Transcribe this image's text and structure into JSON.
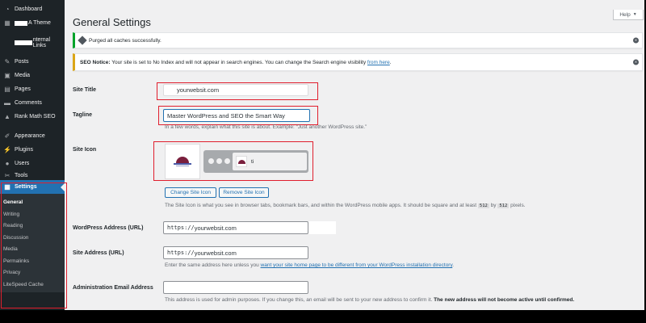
{
  "sidebar": {
    "items": [
      {
        "label": "Dashboard",
        "icon": "dashboard-icon",
        "glyph": "◔"
      },
      {
        "label": "A Theme",
        "icon": "theme-icon",
        "glyph": "▦",
        "redacted_prefix": true
      },
      {
        "label": "nternal Links",
        "icon": "link-icon",
        "glyph": "",
        "redacted_prefix_wide": true
      },
      {
        "label": "Posts",
        "icon": "pin-icon",
        "glyph": "✎"
      },
      {
        "label": "Media",
        "icon": "media-icon",
        "glyph": "▣"
      },
      {
        "label": "Pages",
        "icon": "pages-icon",
        "glyph": "▤"
      },
      {
        "label": "Comments",
        "icon": "comment-icon",
        "glyph": "▬"
      },
      {
        "label": "Rank Math SEO",
        "icon": "rank-math-icon",
        "glyph": "▲"
      },
      {
        "label": "Appearance",
        "icon": "brush-icon",
        "glyph": "✐"
      },
      {
        "label": "Plugins",
        "icon": "plugin-icon",
        "glyph": "⚡"
      },
      {
        "label": "Users",
        "icon": "user-icon",
        "glyph": "●"
      },
      {
        "label": "Tools",
        "icon": "wrench-icon",
        "glyph": "✂"
      },
      {
        "label": "Settings",
        "icon": "settings-icon",
        "glyph": "▦"
      }
    ],
    "submenu": [
      "General",
      "Writing",
      "Reading",
      "Discussion",
      "Media",
      "Permalinks",
      "Privacy",
      "LiteSpeed Cache"
    ],
    "accent": "#2271b1"
  },
  "header": {
    "title": "General Settings",
    "help_label": "Help",
    "help_arrow": "▼"
  },
  "notices": {
    "purge": "Purged all caches successfully.",
    "seo_bold": "SEO Notice:",
    "seo_text": " Your site is set to No Index and will not appear in search engines. You can change the Search engine visibility ",
    "seo_link": "from here",
    "seo_end": ".",
    "dismiss_glyph": "×"
  },
  "form": {
    "site_title": {
      "label": "Site Title",
      "value": "yourwebsit.com"
    },
    "tagline": {
      "label": "Tagline",
      "value": "Master WordPress and SEO the Smart Way",
      "desc": "In a few words, explain what this site is about. Example: “Just another WordPress site.”"
    },
    "site_icon": {
      "label": "Site Icon",
      "tab_title": "ti",
      "change_button": "Change Site Icon",
      "remove_button": "Remove Site Icon",
      "desc_pre": "The Site Icon is what you see in browser tabs, bookmark bars, and within the WordPress mobile apps. It should be square and at least ",
      "code1": "512",
      "by": " by ",
      "code2": "512",
      "desc_post": " pixels."
    },
    "wp_address": {
      "label": "WordPress Address (URL)",
      "prefix": "https://",
      "value": "yourwebsit.com"
    },
    "site_address": {
      "label": "Site Address (URL)",
      "prefix": "https://",
      "value": "yourwebsit.com",
      "desc_pre": "Enter the same address here unless you ",
      "desc_link": "want your site home page to be different from your WordPress installation directory",
      "desc_post": "."
    },
    "admin_email": {
      "label": "Administration Email Address",
      "value": "",
      "desc_pre": "This address is used for admin purposes. If you change this, an email will be sent to your new address to confirm it. ",
      "desc_bold": "The new address will not become active until confirmed."
    }
  },
  "colors": {
    "highlight": "#e01e2d",
    "success": "#00a32a",
    "warning": "#dba617"
  }
}
